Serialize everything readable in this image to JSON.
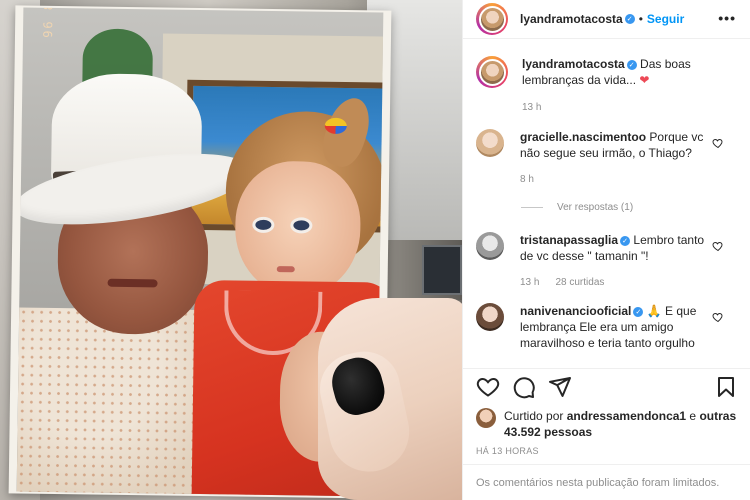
{
  "photo": {
    "date_stamp": "96 8 '61"
  },
  "header": {
    "username": "lyandramotacosta",
    "separator": "•",
    "follow_label": "Seguir",
    "more_label": "•••"
  },
  "caption": {
    "username": "lyandramotacosta",
    "text": "Das boas lembranças da vida... ",
    "heart": "❤",
    "time": "13 h"
  },
  "comments": [
    {
      "username": "gracielle.nascimentoo",
      "text": "Porque vc não segue seu irmão, o Thiago?",
      "time": "8 h",
      "view_replies": "Ver respostas (1)"
    },
    {
      "username": "tristanapassaglia",
      "text": "Lembro tanto de vc desse \" tamanin \"!",
      "time": "13 h",
      "likes": "28 curtidas"
    },
    {
      "username": "nanivenanciooficial",
      "emoji": "🙏",
      "text": "E que lembrança Ele era um amigo maravilhoso e teria tanto orgulho"
    }
  ],
  "likes": {
    "prefix": "Curtido por ",
    "user": "andressamendonca1",
    "middle": " e ",
    "others": "outras 43.592 pessoas"
  },
  "timestamp": "HÁ 13 HORAS",
  "limited_comments": "Os comentários nesta publicação foram limitados.",
  "colors": {
    "link": "#0095f6",
    "verified": "#3897f0",
    "muted": "#8e8e8e",
    "heart": "#ed4956"
  },
  "icons": [
    "more-options-icon",
    "heart-icon",
    "comment-icon",
    "share-icon",
    "bookmark-icon",
    "verified-icon",
    "small-heart-icon"
  ]
}
